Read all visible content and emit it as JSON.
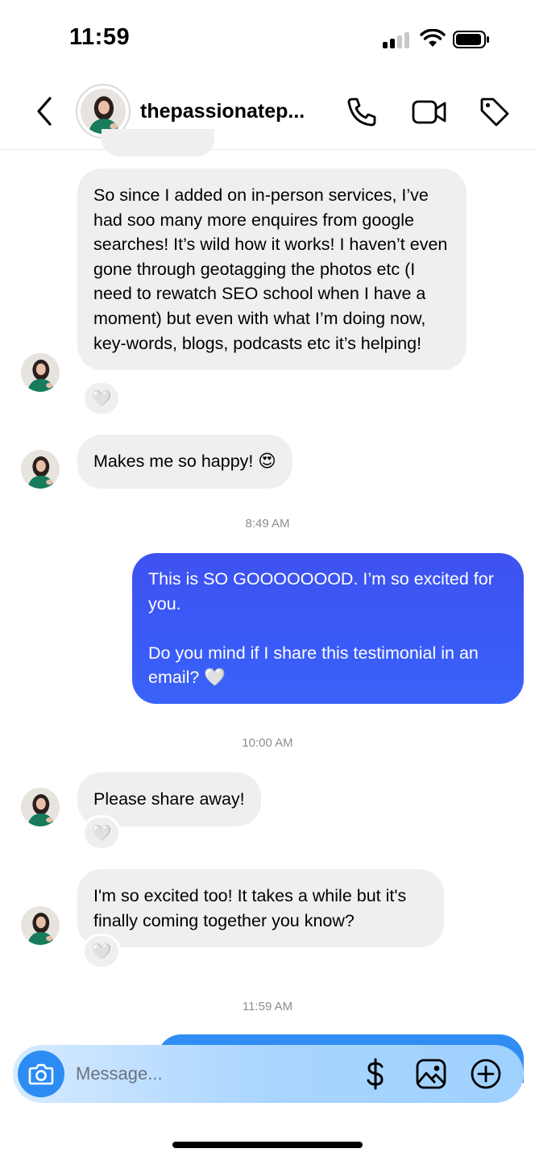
{
  "status_bar": {
    "time": "11:59"
  },
  "header": {
    "username": "thepassionatep..."
  },
  "messages": {
    "m1": "So since I added on in-person services, I’ve had soo many more enquires from google searches! It’s wild how it works! I haven’t even gone through geotagging the photos etc (I need to rewatch SEO school when I have a moment) but even with what I’m doing now, key-words, blogs, podcasts etc it’s helping!",
    "m2": "Makes me so happy! 😍",
    "ts1": "8:49 AM",
    "m3": "This is SO GOOOOOOOD. I’m so excited for you.\n\nDo you mind if I share this testimonial in an email? 🤍",
    "ts2": "10:00 AM",
    "m4": "Please share away!",
    "m5": "I'm so excited too! It takes a while but it's finally coming together you know?",
    "ts3": "11:59 AM"
  },
  "reactions": {
    "heart": "🤍"
  },
  "composer": {
    "placeholder": "Message..."
  },
  "colors": {
    "outgoing_bubble": "#3f52f0",
    "incoming_bubble": "#efefef",
    "accent": "#2d8cf3"
  }
}
